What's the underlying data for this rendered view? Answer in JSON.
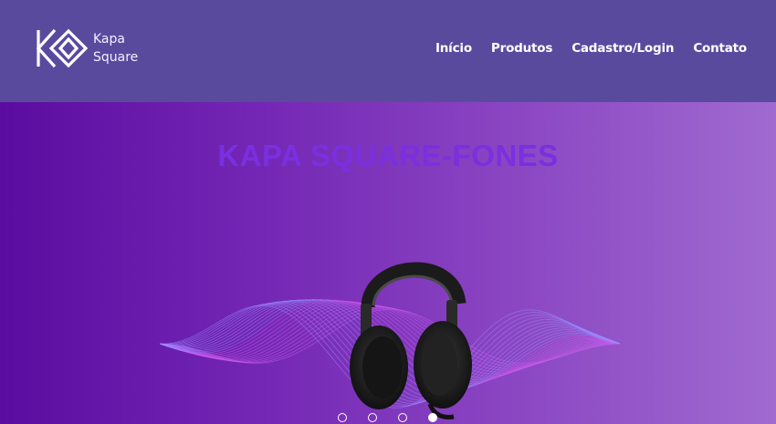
{
  "brand": {
    "line1": "Kapa",
    "line2": "Square"
  },
  "nav": [
    {
      "label": "Início"
    },
    {
      "label": "Produtos"
    },
    {
      "label": "Cadastro/Login"
    },
    {
      "label": "Contato"
    }
  ],
  "hero": {
    "title": "KAPA SQUARE-FONES",
    "carousel": {
      "slide_count": 4,
      "active_index": 3
    }
  },
  "colors": {
    "header_bg": "#5a4a9e",
    "title": "#7a2fe0",
    "hero_gradient": [
      "#5a0ca0",
      "#a06ad0"
    ]
  }
}
